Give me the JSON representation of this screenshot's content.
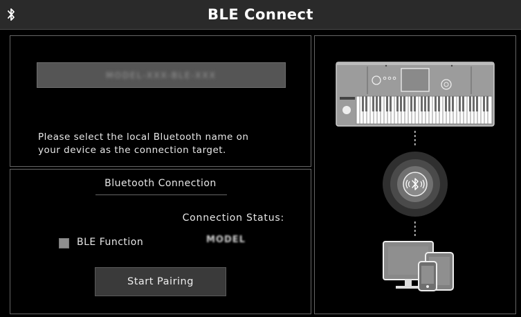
{
  "title": "BLE Connect",
  "name_panel": {
    "device_name": "MODEL-XXX-BLE-XXX",
    "hint_line1": "Please select the local Bluetooth name on",
    "hint_line2": "your device as the connection target."
  },
  "connection": {
    "section_title": "Bluetooth Connection",
    "status_label": "Connection Status:",
    "status_value": "MODEL",
    "ble_function_label": "BLE Function",
    "ble_function_checked": false,
    "pair_button": "Start Pairing"
  },
  "icons": {
    "title": "bluetooth-icon",
    "keyboard": "keyboard-illustration",
    "bluetooth_hub": "bluetooth-broadcast-icon",
    "devices": "devices-illustration"
  },
  "colors": {
    "background": "#000000",
    "titlebar": "#2a2a2a",
    "panel_border": "#666666",
    "button": "#3a3a3a",
    "field": "#555555"
  }
}
